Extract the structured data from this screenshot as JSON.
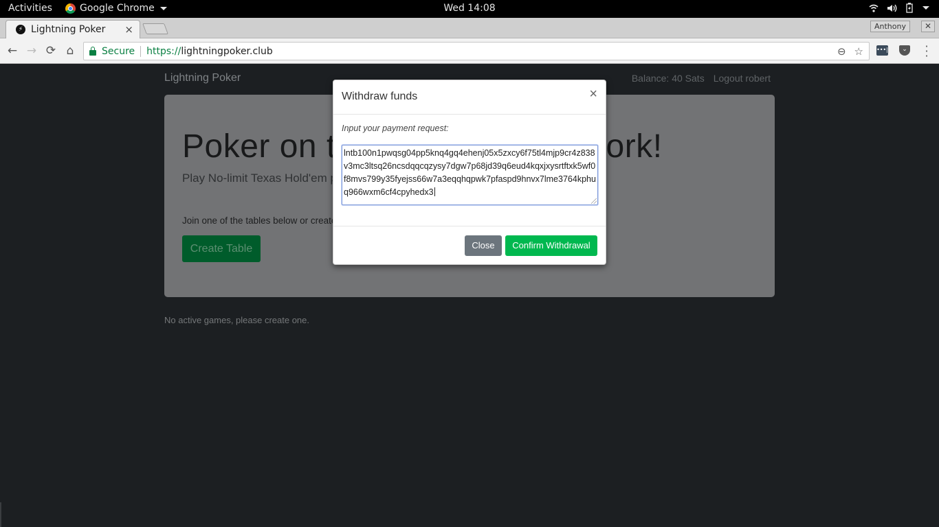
{
  "system_bar": {
    "activities": "Activities",
    "app_name": "Google Chrome",
    "clock": "Wed 14:08",
    "tray_icons": [
      "wifi-icon",
      "volume-icon",
      "battery-icon",
      "chevron-down-icon"
    ]
  },
  "browser": {
    "tab_title": "Lightning Poker",
    "tab_close": "×",
    "profile_name": "Anthony",
    "window_close": "✕",
    "nav": {
      "back": "←",
      "forward": "→",
      "reload": "⟳",
      "home": "⌂"
    },
    "security_label": "Secure",
    "url_scheme": "https://",
    "url_host": "lightningpoker.club",
    "zoom_icon": "⊖",
    "bookmark_icon": "☆",
    "menu_icon": "⋮"
  },
  "page": {
    "brand": "Lightning Poker",
    "balance": "Balance: 40 Sats",
    "logout": "Logout robert",
    "hero_title": "Poker on the Lightning Network!",
    "hero_lead": "Play No-limit Texas Hold'em poker with Bitcoin on the Lightning Network.",
    "join_text": "Join one of the tables below or create your own.",
    "create_table": "Create Table",
    "no_games": "No active games, please create one."
  },
  "modal": {
    "title": "Withdraw funds",
    "close_x": "×",
    "label": "Input your payment request:",
    "payment_request": "lntb100n1pwqsg04pp5knq4gq4ehenj05x5zxcy6f75tl4mjp9cr4z838v3mc3ltsq26ncsdqqcqzysy7dgw7p68jd39q6eud4kqxjxysrtftxk5wf0f8mvs799y35fyejss66w7a3eqqhqpwk7pfaspd9hnvx7lme3764kphuq966wxm6cf4cpyhedx3",
    "close_button": "Close",
    "confirm_button": "Confirm Withdrawal"
  },
  "colors": {
    "page_bg": "#1c1f22",
    "jumbotron_bg": "#727375",
    "confirm_green": "#00b84f",
    "close_gray": "#6c757d",
    "secure_green": "#0b8043"
  }
}
